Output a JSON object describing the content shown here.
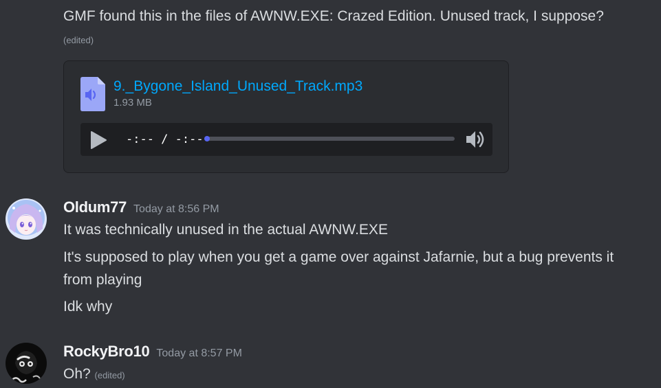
{
  "messages": [
    {
      "content": "GMF found this in the files of AWNW.EXE: Crazed Edition. Unused track, I suppose?",
      "edited_label": "(edited)",
      "attachment": {
        "file_name": "9._Bygone_Island_Unused_Track.mp3",
        "file_size": "1.93 MB",
        "time_display": "-:-- / -:--",
        "progress": 0
      }
    },
    {
      "username": "Oldum77",
      "timestamp": "Today at 8:56 PM",
      "lines": [
        "It was technically unused in the actual AWNW.EXE",
        "It's supposed to play when you get a game over against Jafarnie, but a bug prevents it",
        "from playing",
        "Idk why"
      ]
    },
    {
      "username": "RockyBro10",
      "timestamp": "Today at 8:57 PM",
      "content": "Oh?",
      "edited_label": "(edited)"
    }
  ],
  "colors": {
    "background": "#313338",
    "attachment_bg": "#2b2d31",
    "player_bg": "#1e1f22",
    "link": "#00a8fc",
    "accent": "#5865f2",
    "muted": "#949ba4",
    "text": "#dbdee1"
  },
  "icons": {
    "file": "audio-file-icon",
    "play": "play-icon",
    "volume": "volume-icon"
  }
}
